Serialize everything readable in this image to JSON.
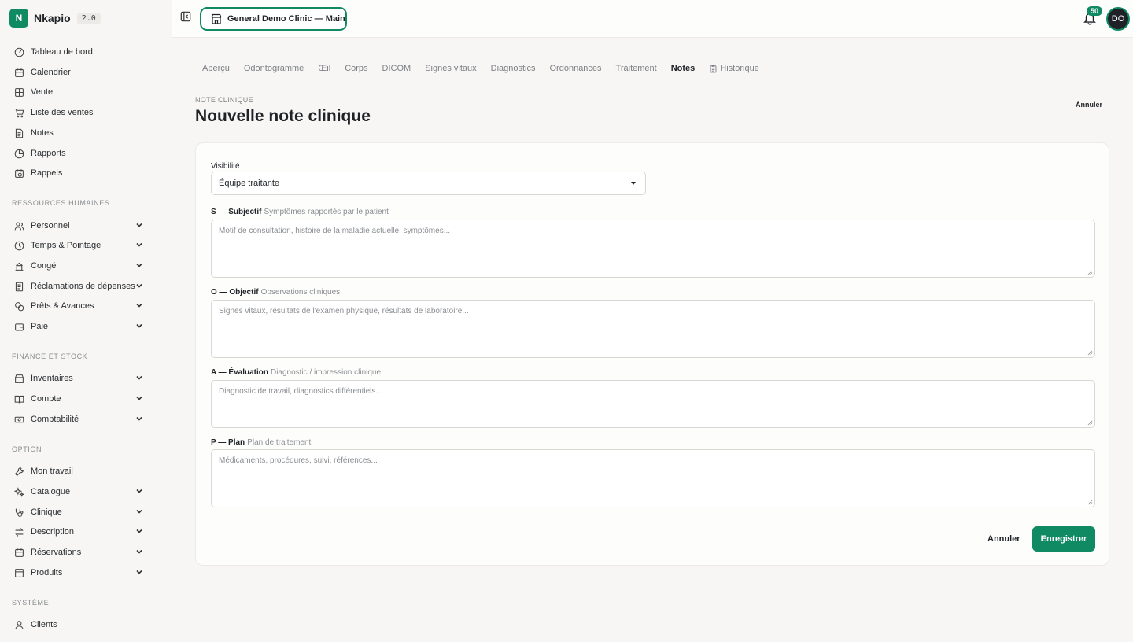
{
  "brand": {
    "name": "Nkapio",
    "version": "2.0"
  },
  "sidebar": {
    "main_items": [
      {
        "label": "Tableau de bord",
        "icon": "dashboard-icon"
      },
      {
        "label": "Calendrier",
        "icon": "calendar-icon"
      },
      {
        "label": "Vente",
        "icon": "grid-icon"
      },
      {
        "label": "Liste des ventes",
        "icon": "cart-icon"
      },
      {
        "label": "Notes",
        "icon": "document-icon"
      },
      {
        "label": "Rapports",
        "icon": "pie-chart-icon"
      },
      {
        "label": "Rappels",
        "icon": "calendar-clock-icon"
      }
    ],
    "sections": [
      {
        "title": "RESSOURCES HUMAINES",
        "items": [
          "Personnel",
          "Temps & Pointage",
          "Congé",
          "Réclamations de dépenses",
          "Prêts & Avances",
          "Paie"
        ]
      },
      {
        "title": "FINANCE ET STOCK",
        "items": [
          "Inventaires",
          "Compte",
          "Comptabilité"
        ]
      },
      {
        "title": "OPTION",
        "items": [
          "Mon travail",
          "Catalogue",
          "Clinique",
          "Description",
          "Réservations",
          "Produits"
        ]
      },
      {
        "title": "SYSTÈME",
        "items": [
          "Clients"
        ]
      }
    ]
  },
  "topbar": {
    "branch": "General Demo Clinic — Main",
    "notification_count": "50",
    "avatar_initials": "DO"
  },
  "tabs": [
    "Aperçu",
    "Odontogramme",
    "Œil",
    "Corps",
    "DICOM",
    "Signes vitaux",
    "Diagnostics",
    "Ordonnances",
    "Traitement",
    "Notes",
    "Historique"
  ],
  "active_tab": "Notes",
  "page": {
    "eyebrow": "NOTE CLINIQUE",
    "title": "Nouvelle note clinique",
    "cancel_top": "Annuler"
  },
  "form": {
    "visibility_label": "Visibilité",
    "visibility_value": "Équipe traitante",
    "subjective": {
      "label": "S — Subjectif",
      "hint": "Symptômes rapportés par le patient",
      "placeholder": "Motif de consultation, histoire de la maladie actuelle, symptômes..."
    },
    "objective": {
      "label": "O — Objectif",
      "hint": "Observations cliniques",
      "placeholder": "Signes vitaux, résultats de l'examen physique, résultats de laboratoire..."
    },
    "assessment": {
      "label": "A — Évaluation",
      "hint": "Diagnostic / impression clinique",
      "placeholder": "Diagnostic de travail, diagnostics différentiels..."
    },
    "plan": {
      "label": "P — Plan",
      "hint": "Plan de traitement",
      "placeholder": "Médicaments, procédures, suivi, références..."
    },
    "cancel_label": "Annuler",
    "save_label": "Enregistrer"
  },
  "colors": {
    "accent": "#0f8a63",
    "background": "#f7f6f4"
  }
}
